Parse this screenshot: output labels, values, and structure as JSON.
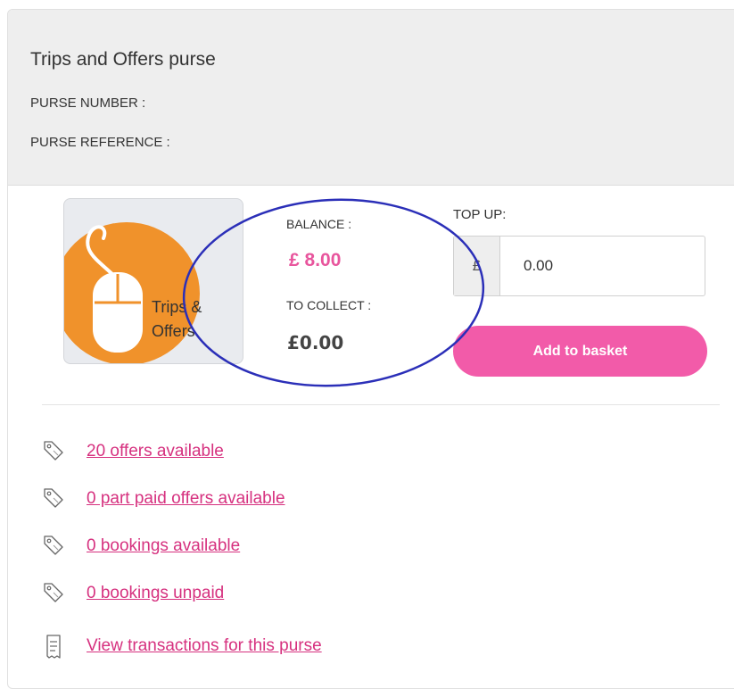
{
  "purse": {
    "title": "Trips and Offers purse",
    "number_label": "PURSE NUMBER :",
    "reference_label": "PURSE REFERENCE :",
    "image_label_line1": "Trips &",
    "image_label_line2": "Offers",
    "image_icon": "mouse-icon"
  },
  "balance": {
    "balance_label": "BALANCE :",
    "balance_value": "£ 8.00",
    "collect_label": "TO COLLECT :",
    "collect_value": "£0.00"
  },
  "topup": {
    "label": "TOP UP:",
    "currency_prefix": "£",
    "value": "0.00",
    "button_label": "Add to basket"
  },
  "links": [
    {
      "icon": "tag-icon",
      "label": "20 offers available"
    },
    {
      "icon": "tag-icon",
      "label": "0 part paid offers available"
    },
    {
      "icon": "tag-icon",
      "label": "0 bookings available"
    },
    {
      "icon": "tag-icon",
      "label": "0 bookings unpaid"
    },
    {
      "icon": "receipt-icon",
      "label": "View transactions for this purse"
    }
  ],
  "colors": {
    "accent_pink": "#f25ba9",
    "link_pink": "#d6317f",
    "header_bg": "#eeeeee",
    "annotation_blue": "#2b2fb8",
    "icon_orange": "#f0922b"
  }
}
